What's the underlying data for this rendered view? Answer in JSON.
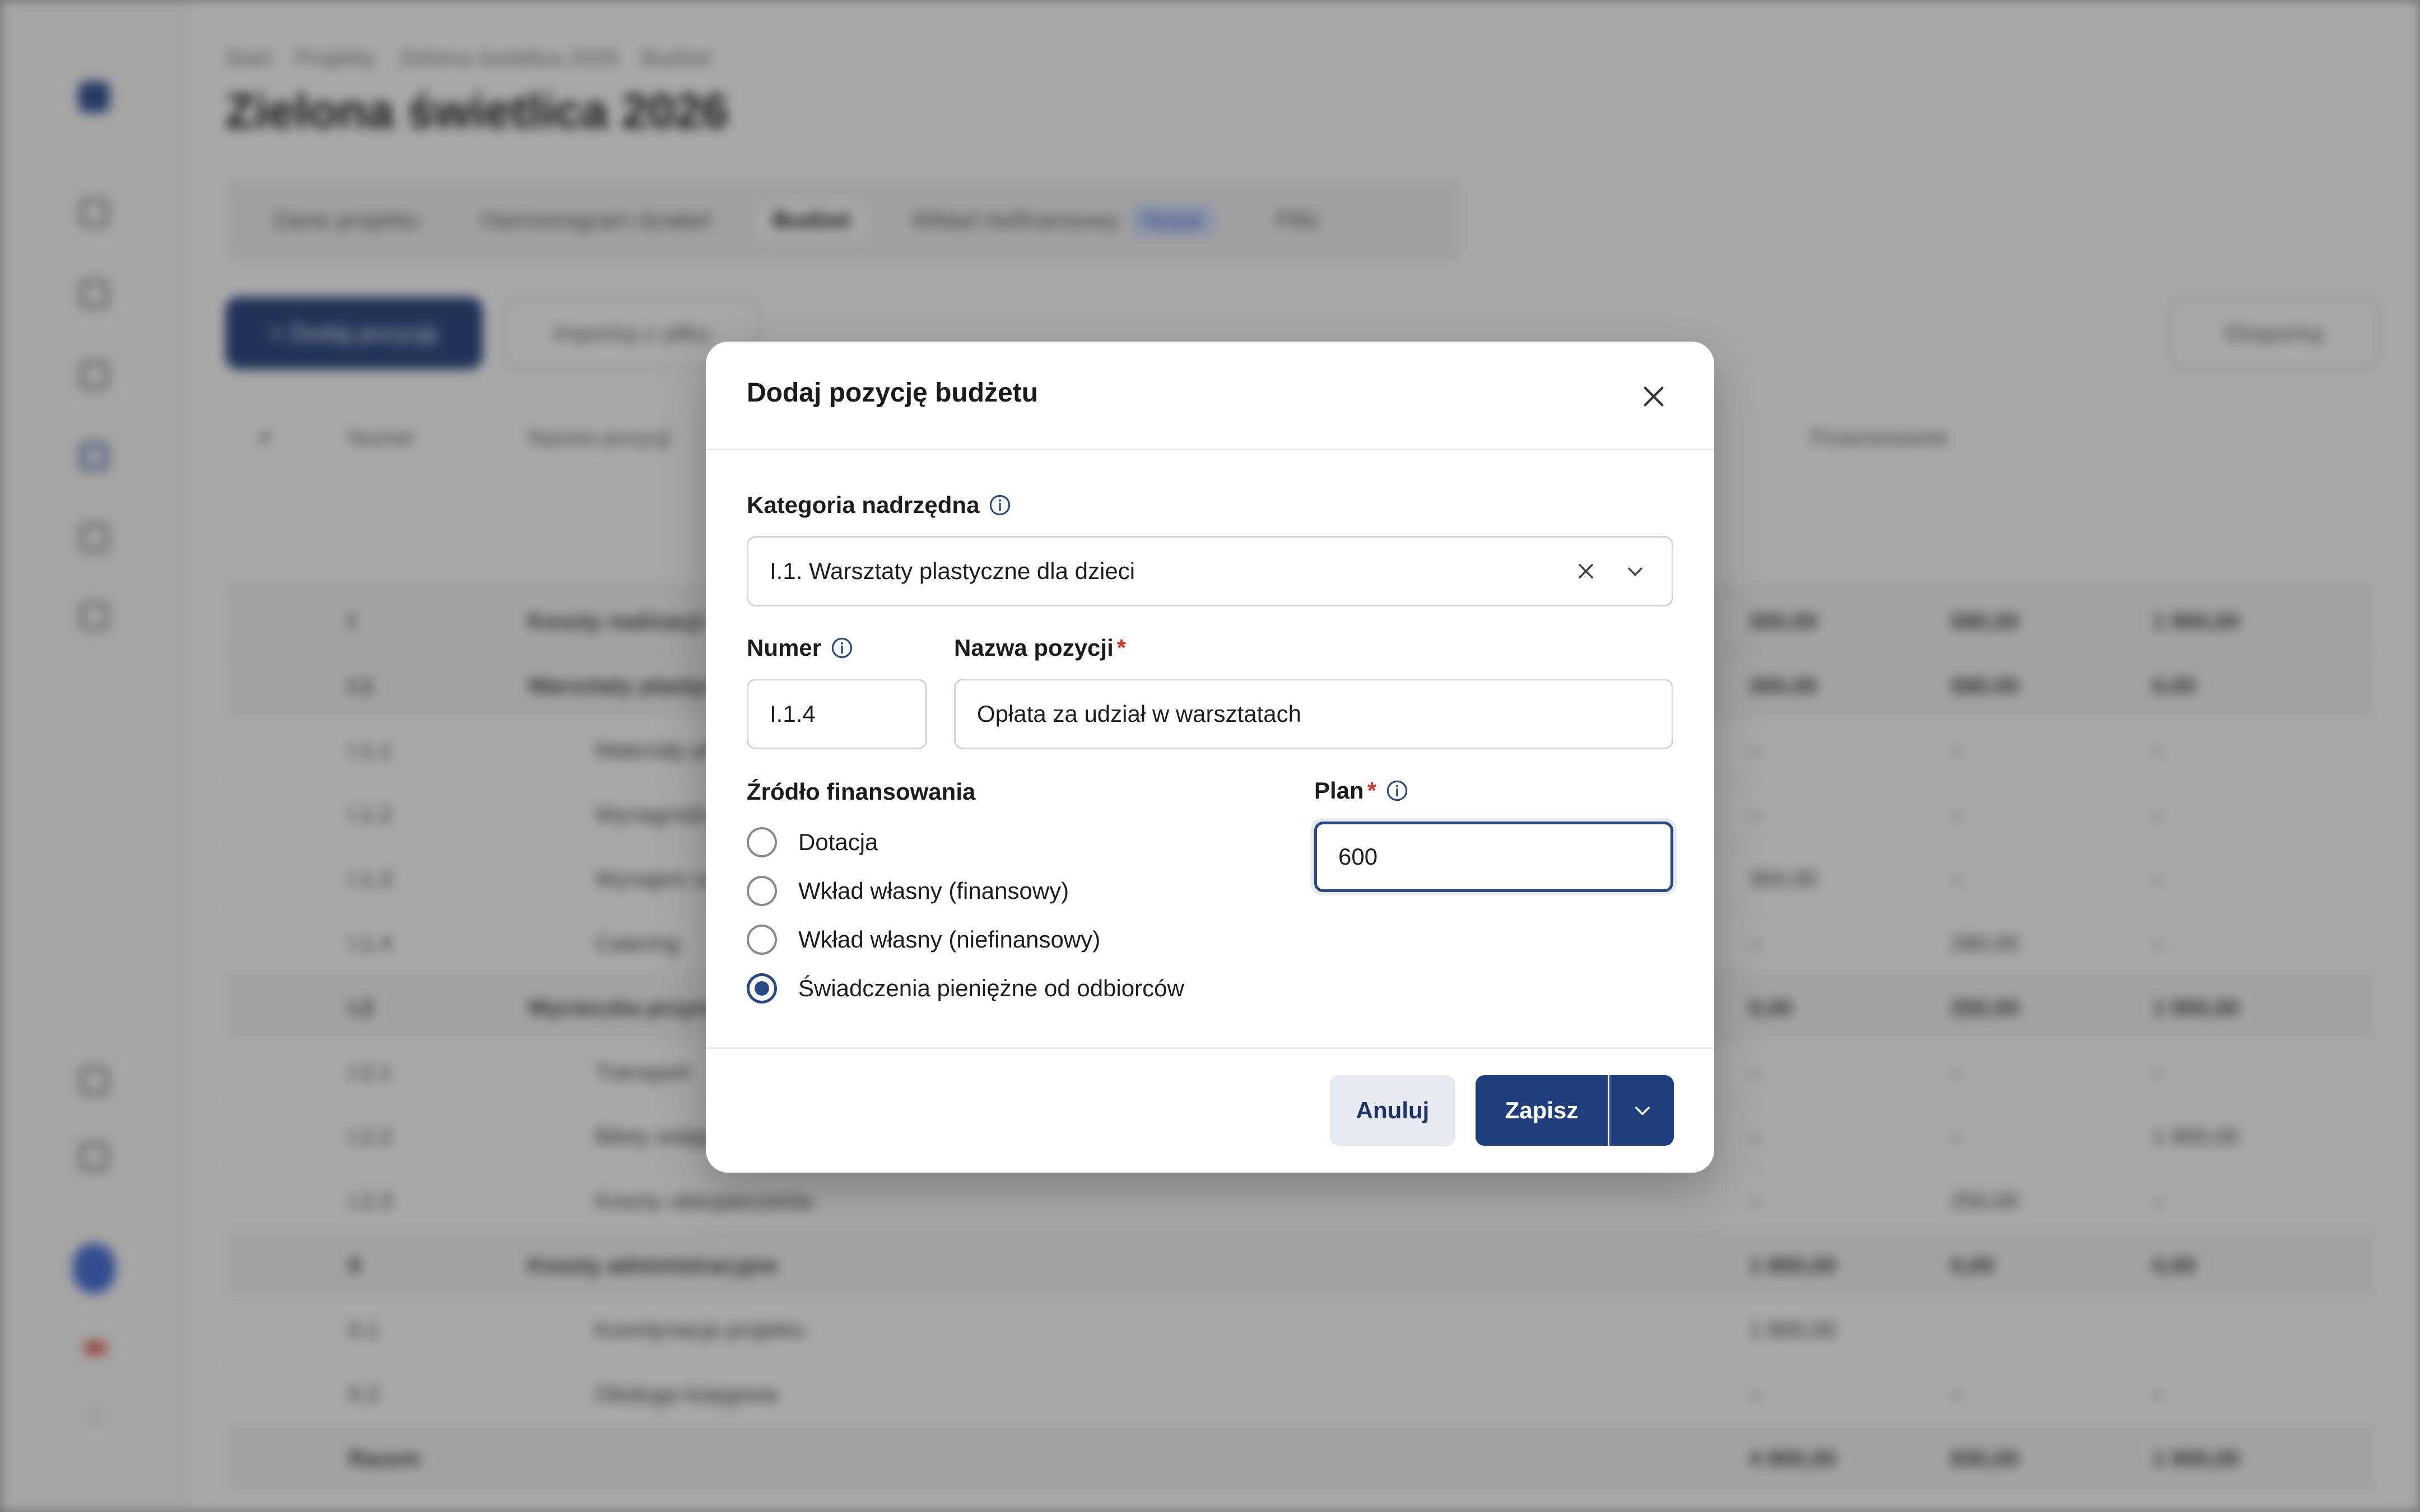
{
  "background": {
    "breadcrumb": [
      "Start",
      "Projekty",
      "Zielona świetlica 2026",
      "Budżet"
    ],
    "page_title": "Zielona świetlica 2026",
    "tabs": [
      {
        "label": "Dane projektu",
        "active": false
      },
      {
        "label": "Harmonogram działań",
        "active": false
      },
      {
        "label": "Budżet",
        "active": true
      },
      {
        "label": "Wkład niefinansowy",
        "active": false,
        "badge": "Nowe"
      },
      {
        "label": "Pliki",
        "active": false
      }
    ],
    "add_button": "+ Dodaj pozycję",
    "import_button": "Importuj z pliku",
    "export_button": "Eksportuj",
    "columns": [
      "#",
      "Numer",
      "Nazwa pozycji",
      "Finansowanie"
    ],
    "rows": [
      {
        "num": "I",
        "name": "Koszty realizacji działań",
        "v1": "300,00",
        "v2": "580,00",
        "v3": "1 900,00",
        "group": true
      },
      {
        "num": "I.1",
        "name": "Warsztaty plastyczne dla dzieci",
        "v1": "300,00",
        "v2": "580,00",
        "v3": "0,00",
        "group": true
      },
      {
        "num": "I.1.1",
        "name": "Materiały plastyczne",
        "v1": "–",
        "v2": "–",
        "v3": "–",
        "group": false
      },
      {
        "num": "I.1.2",
        "name": "Wynagrodzenie prowadzącego",
        "v1": "–",
        "v2": "–",
        "v3": "–",
        "group": false
      },
      {
        "num": "I.1.3",
        "name": "Wynajem sali",
        "v1": "300,00",
        "v2": "–",
        "v3": "–",
        "group": false
      },
      {
        "num": "I.1.4",
        "name": "Catering",
        "v1": "–",
        "v2": "280,00",
        "v3": "–",
        "group": false
      },
      {
        "num": "I.2",
        "name": "Wycieczka przyrodnicza",
        "v1": "0,00",
        "v2": "250,00",
        "v3": "1 900,00",
        "group": true
      },
      {
        "num": "I.2.1",
        "name": "Transport",
        "v1": "–",
        "v2": "–",
        "v3": "–",
        "group": false
      },
      {
        "num": "I.2.2",
        "name": "Bilety wstępu",
        "v1": "–",
        "v2": "–",
        "v3": "1 900,00",
        "group": false
      },
      {
        "num": "I.2.3",
        "name": "Koszty ubezpieczenia",
        "v1": "–",
        "v2": "250,00",
        "v3": "–",
        "group": false
      },
      {
        "num": "II",
        "name": "Koszty administracyjne",
        "v1": "1 800,00",
        "v2": "0,00",
        "v3": "0,00",
        "group": true
      },
      {
        "num": "II.1",
        "name": "Koordynacja projektu",
        "v1": "1 800,00",
        "v2": "",
        "v3": "",
        "group": false
      },
      {
        "num": "II.2",
        "name": "Obsługa księgowa",
        "v1": "–",
        "v2": "–",
        "v3": "–",
        "group": false
      }
    ],
    "total_row": {
      "label": "Razem",
      "v1": "4 800,00",
      "v2": "830,00",
      "v3": "1 900,00"
    }
  },
  "dialog": {
    "title": "Dodaj pozycję budżetu",
    "parent_category": {
      "label": "Kategoria nadrzędna",
      "value": "I.1. Warsztaty plastyczne dla dzieci"
    },
    "number": {
      "label": "Numer",
      "value": "I.1.4"
    },
    "item_name": {
      "label": "Nazwa pozycji",
      "required_mark": "*",
      "value": "Opłata za udział w warsztatach"
    },
    "funding_source": {
      "label": "Źródło finansowania",
      "options": [
        {
          "label": "Dotacja",
          "checked": false
        },
        {
          "label": "Wkład własny (finansowy)",
          "checked": false
        },
        {
          "label": "Wkład własny (niefinansowy)",
          "checked": false
        },
        {
          "label": "Świadczenia pieniężne od odbiorców",
          "checked": true
        }
      ]
    },
    "plan": {
      "label": "Plan",
      "required_mark": "*",
      "value": "600"
    },
    "cancel_label": "Anuluj",
    "save_label": "Zapisz"
  },
  "colors": {
    "primary": "#1e3e7c",
    "required": "#d9342b",
    "cancel_bg": "#e7eaf1"
  }
}
